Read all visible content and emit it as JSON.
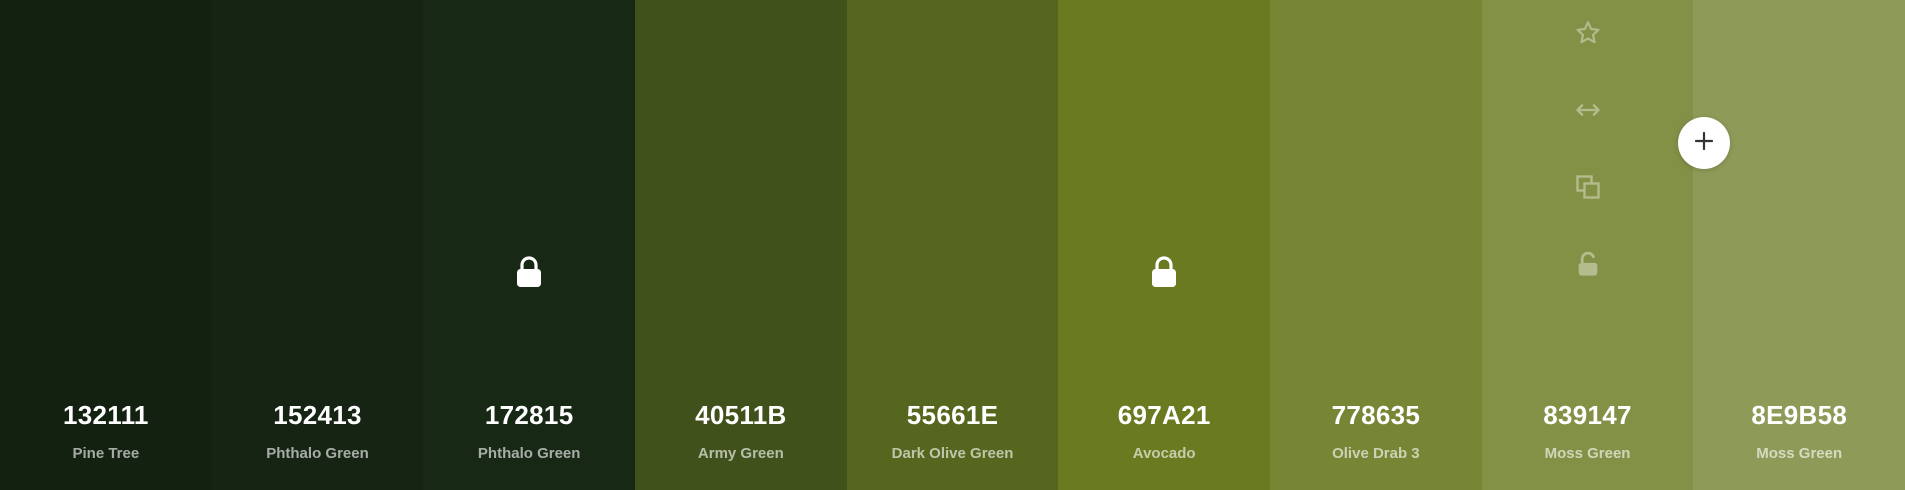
{
  "palette": {
    "swatches": [
      {
        "hex": "132111",
        "name": "Pine Tree",
        "color": "#132111",
        "text_color": "#ffffff",
        "locked": false
      },
      {
        "hex": "152413",
        "name": "Phthalo Green",
        "color": "#152413",
        "text_color": "#ffffff",
        "locked": false
      },
      {
        "hex": "172815",
        "name": "Phthalo Green",
        "color": "#172815",
        "text_color": "#ffffff",
        "locked": true
      },
      {
        "hex": "40511B",
        "name": "Army Green",
        "color": "#40511B",
        "text_color": "#ffffff",
        "locked": false
      },
      {
        "hex": "55661E",
        "name": "Dark Olive Green",
        "color": "#55661E",
        "text_color": "#ffffff",
        "locked": false
      },
      {
        "hex": "697A21",
        "name": "Avocado",
        "color": "#697A21",
        "text_color": "#ffffff",
        "locked": true
      },
      {
        "hex": "778635",
        "name": "Olive Drab 3",
        "color": "#778635",
        "text_color": "#ffffff",
        "locked": false
      },
      {
        "hex": "839147",
        "name": "Moss Green",
        "color": "#839147",
        "text_color": "#ffffff",
        "locked": false,
        "hovered": true
      },
      {
        "hex": "8E9B58",
        "name": "Moss Green",
        "color": "#8E9B58",
        "text_color": "#ffffff",
        "locked": false
      }
    ]
  },
  "toolbar_icons": [
    "star-icon",
    "arrows-horizontal-icon",
    "copy-icon",
    "unlock-icon"
  ],
  "add_button_icon": "plus-icon",
  "colors": {
    "tool_icon": "#b4bc8e",
    "add_icon": "#333333",
    "lock_icon": "#ffffff"
  }
}
